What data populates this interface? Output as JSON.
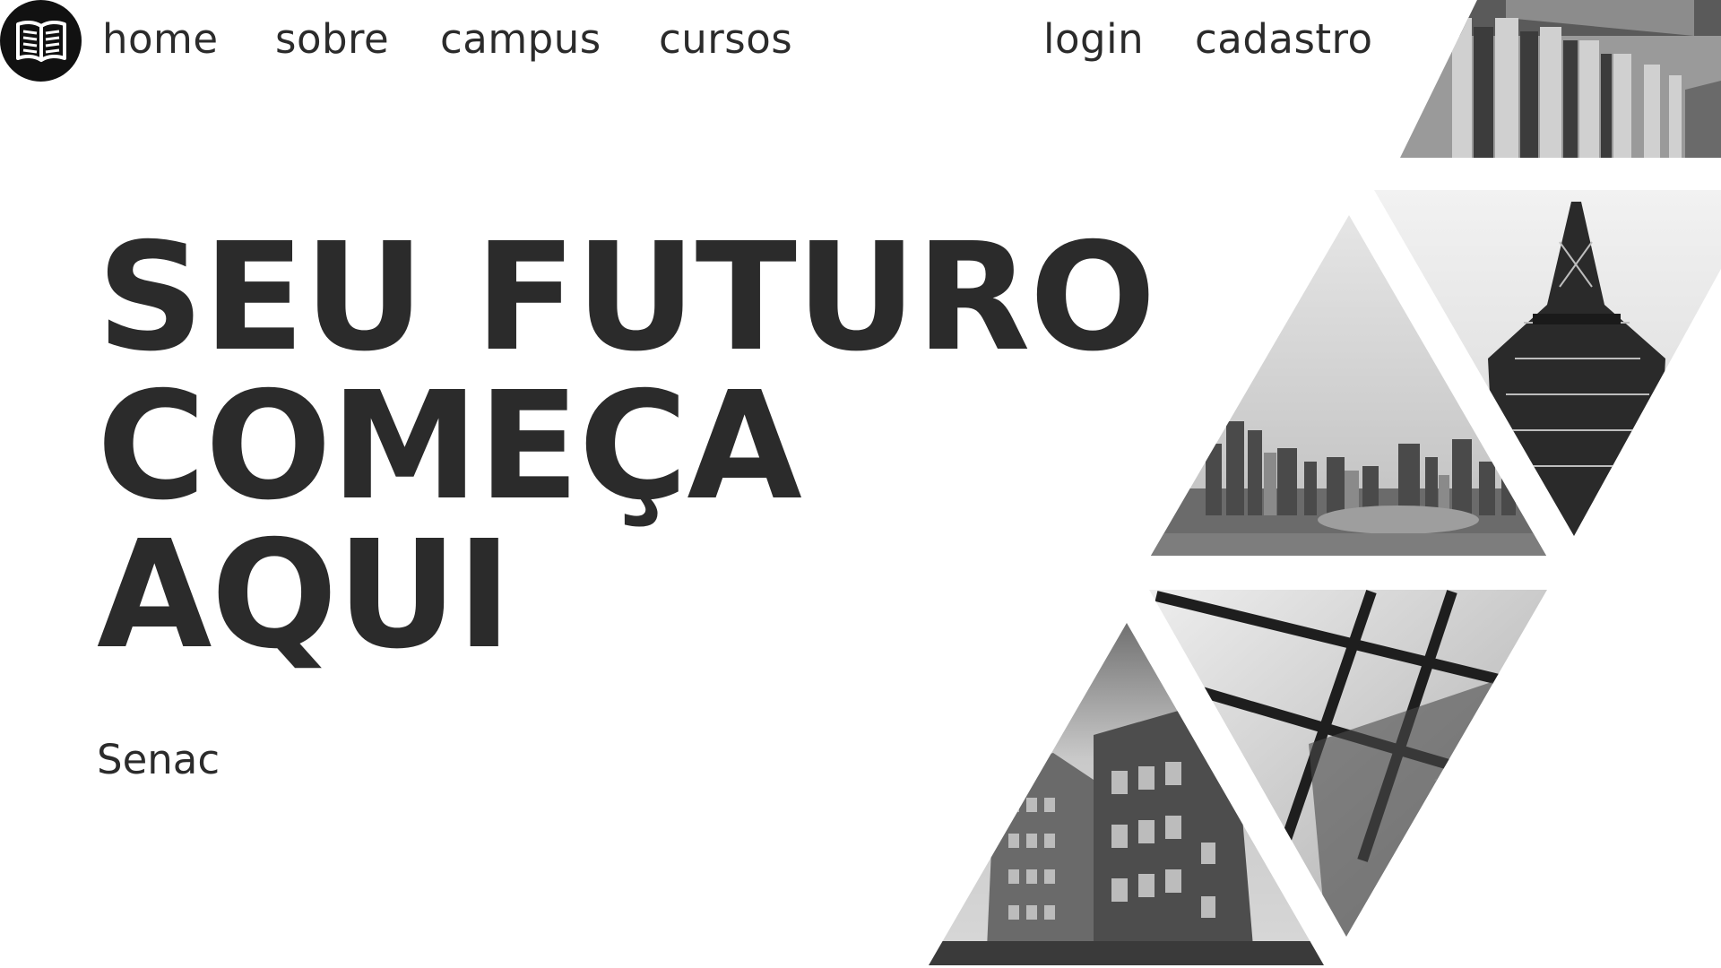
{
  "nav": {
    "logo_icon": "open-book-icon",
    "links": [
      "home",
      "sobre",
      "campus",
      "cursos"
    ],
    "auth": [
      "login",
      "cadastro"
    ]
  },
  "hero": {
    "title_lines": [
      "SEU FUTURO",
      "COMEÇA",
      "AQUI"
    ],
    "subtitle": "Senac"
  },
  "gallery": {
    "images": [
      "columns-building",
      "skyline-city",
      "eiffel-tower",
      "glass-roof",
      "brick-buildings"
    ],
    "style": "grayscale triangles"
  }
}
